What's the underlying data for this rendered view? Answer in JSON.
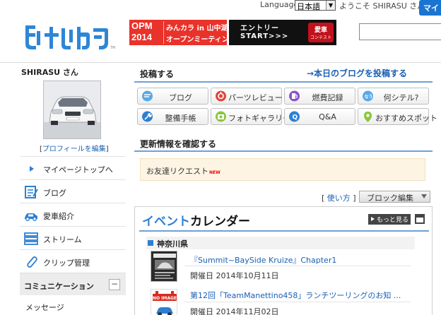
{
  "header": {
    "language_label": "Language",
    "language_value": "日本語",
    "welcome": "ようこそ SHIRASU さん",
    "top_button": "マイ",
    "banner_opm": {
      "line1": "OPM",
      "line2": "2014",
      "text1": "みんカラ in 山中湖",
      "text2": "オープンミーティング"
    },
    "banner_entry": {
      "line1": "エントリー",
      "line2": "START>>>",
      "badge_main": "愛車",
      "badge_sub": "コンテスト"
    },
    "search_placeholder": ""
  },
  "sidebar": {
    "user_name": "SHIRASU さん",
    "edit_profile": "プロフィールを編集",
    "items": [
      {
        "label": "マイページトップへ",
        "icon": "triangle-right-icon"
      },
      {
        "label": "ブログ",
        "icon": "blog-icon"
      },
      {
        "label": "愛車紹介",
        "icon": "car-icon"
      },
      {
        "label": "ストリーム",
        "icon": "stream-icon"
      },
      {
        "label": "クリップ管理",
        "icon": "clip-icon"
      }
    ],
    "community_head": "コミュニケーション",
    "community_items": [
      "メッセージ"
    ]
  },
  "main": {
    "post_title": "投稿する",
    "post_link": "→本日のブログを投稿する",
    "post_buttons": [
      {
        "label": "ブログ",
        "icon": "blog-bubble-icon",
        "color": "#5aa9e6"
      },
      {
        "label": "パーツレビュー",
        "icon": "parts-review-icon",
        "color": "#e3453b"
      },
      {
        "label": "燃費記録",
        "icon": "fuel-record-icon",
        "color": "#8a54c9"
      },
      {
        "label": "何シテル?",
        "icon": "what-doing-icon",
        "color": "#5aa9e6"
      },
      {
        "label": "整備手帳",
        "icon": "maintenance-icon",
        "color": "#2d7fd3"
      },
      {
        "label": "フォトギャラリー",
        "icon": "photo-gallery-icon",
        "color": "#8cc63f"
      },
      {
        "label": "Q&A",
        "icon": "qa-icon",
        "color": "#2d7fd3"
      },
      {
        "label": "おすすめスポット",
        "icon": "spot-icon",
        "color": "#8cc63f"
      }
    ],
    "updates_title": "更新情報を確認する",
    "notice": "お友達リクエスト",
    "notice_badge": "NEW",
    "how_link": "使い方",
    "block_edit": "ブロック編集",
    "calendar": {
      "title_accent": "イベント",
      "title_rest": "カレンダー",
      "more": "もっと見る",
      "prefecture": "神奈川県",
      "events": [
        {
          "title": "『Summit~BaySide Kruize』Chapter1",
          "date": "開催日  2014年10月11日",
          "thumb": "event-flyer-thumbnail"
        },
        {
          "title": "第12回「TeamManettino458」ランチツーリングのお知 ...",
          "date": "開催日  2014年11月02日",
          "thumb": "no-image-thumbnail",
          "no_image": "NO IMAGE"
        }
      ]
    }
  }
}
